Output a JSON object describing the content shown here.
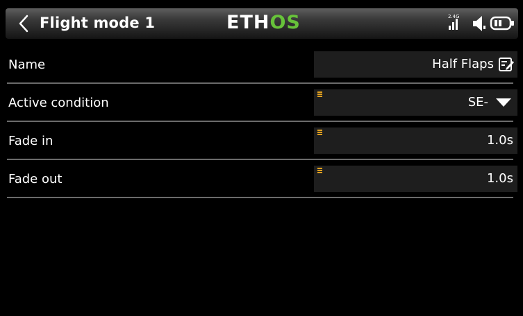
{
  "header": {
    "title": "Flight mode 1",
    "logo": {
      "primary": "ETH",
      "accent": "OS"
    },
    "status": {
      "band": "2.4G"
    }
  },
  "rows": [
    {
      "label": "Name",
      "value": "Half Flaps"
    },
    {
      "label": "Active condition",
      "value": "SE-"
    },
    {
      "label": "Fade in",
      "value": "1.0s"
    },
    {
      "label": "Fade out",
      "value": "1.0s"
    }
  ],
  "colors": {
    "accent": "#67c23a",
    "grip": "#e0a020",
    "field": "#1e1e1e",
    "divider": "#6b6b6b"
  },
  "icons": {
    "back": "chevron-left-icon",
    "edit": "edit-icon",
    "dropdown": "dropdown-triangle-icon"
  }
}
